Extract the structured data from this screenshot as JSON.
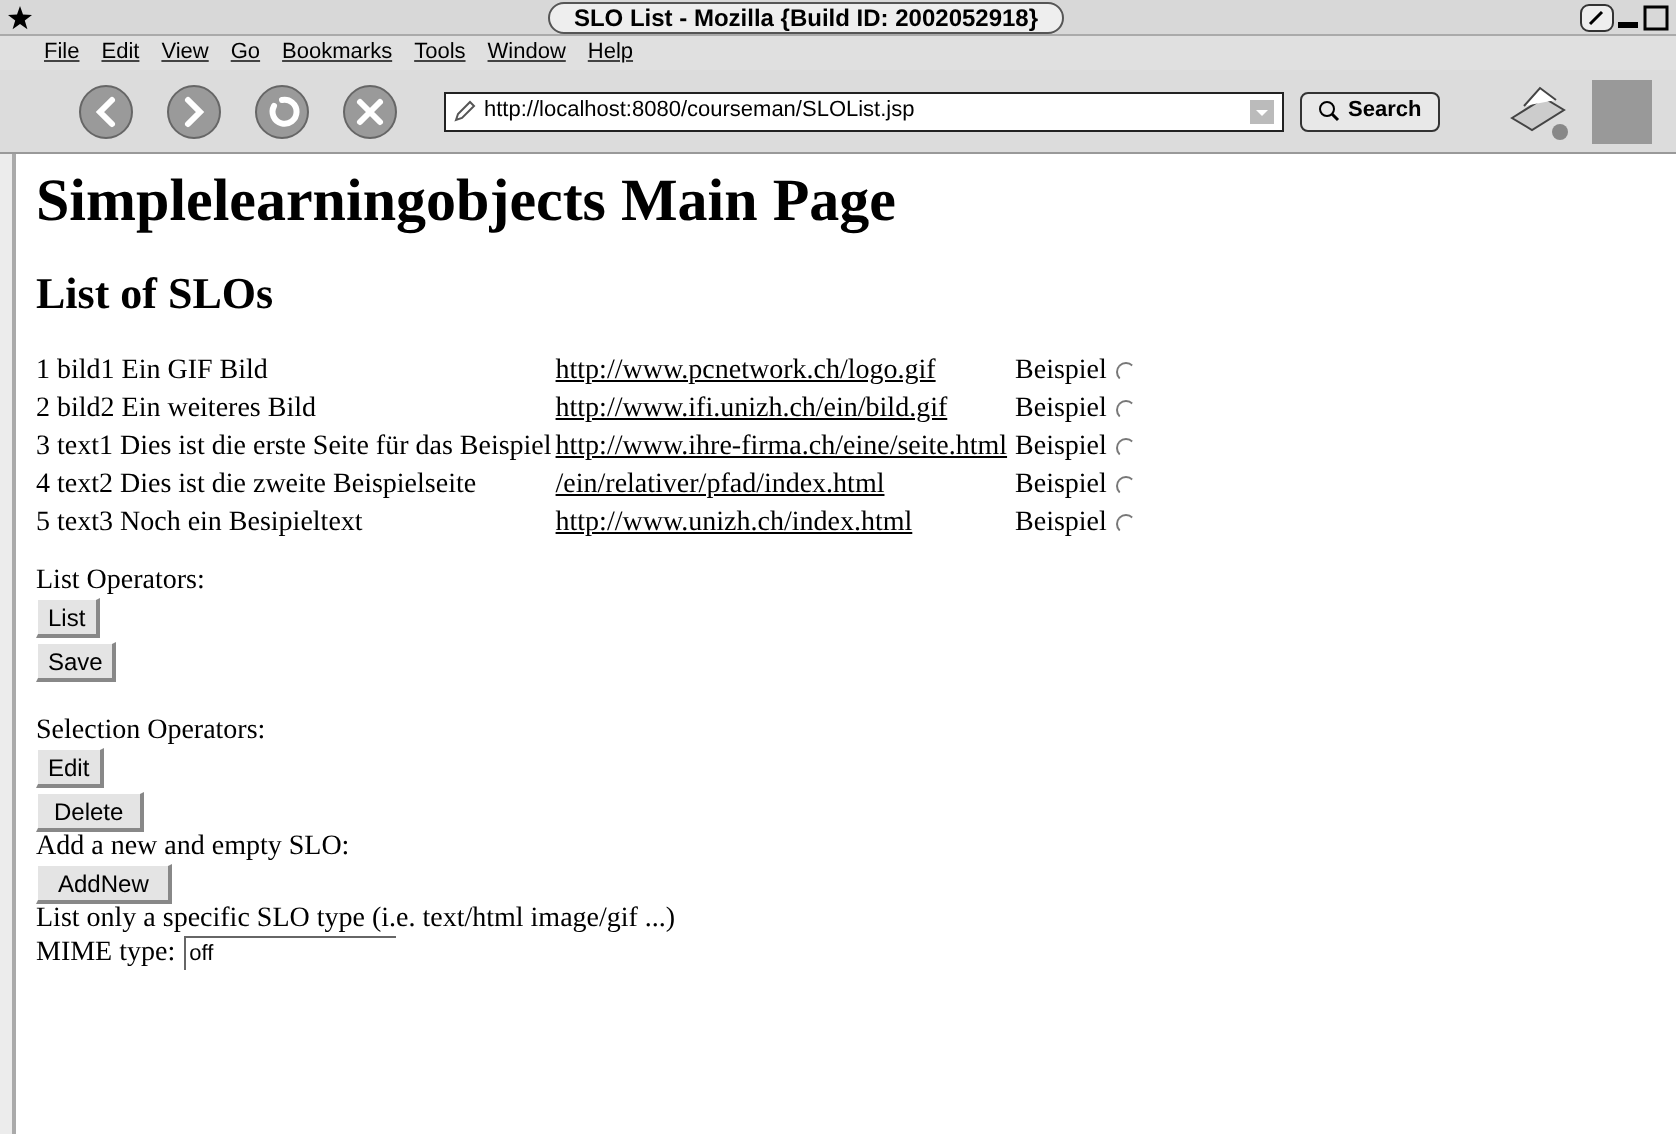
{
  "window": {
    "title": "SLO List - Mozilla {Build ID: 2002052918}"
  },
  "menu": [
    "File",
    "Edit",
    "View",
    "Go",
    "Bookmarks",
    "Tools",
    "Window",
    "Help"
  ],
  "address": {
    "value": "http://localhost:8080/courseman/SLOList.jsp"
  },
  "search_button": "Search",
  "page": {
    "title": "Simplelearningobjects Main Page",
    "subtitle": "List of SLOs",
    "rows": [
      {
        "name": "1 bild1 Ein GIF Bild",
        "url": "http://www.pcnetwork.ch/logo.gif",
        "type": "Beispiel",
        "selected": false
      },
      {
        "name": "2 bild2 Ein weiteres Bild",
        "url": "http://www.ifi.unizh.ch/ein/bild.gif",
        "type": "Beispiel",
        "selected": false
      },
      {
        "name": "3 text1 Dies ist die erste Seite für das Beispiel",
        "url": "http://www.ihre-firma.ch/eine/seite.html",
        "type": "Beispiel",
        "selected": false
      },
      {
        "name": "4 text2 Dies ist die zweite Beispielseite",
        "url": "/ein/relativer/pfad/index.html",
        "type": "Beispiel",
        "selected": false
      },
      {
        "name": "5 text3 Noch ein Besipieltext",
        "url": "http://www.unizh.ch/index.html",
        "type": "Beispiel",
        "selected": false
      }
    ],
    "list_label": "List Operators:",
    "list_buttons": [
      "List",
      "Save"
    ],
    "selection_label": "Selection Operators:",
    "selection_buttons": [
      "Edit",
      "Delete"
    ],
    "add_label": "Add a new and empty SLO:",
    "add_button": "AddNew",
    "filter_text": "List only a specific SLO type (i.e. text/html image/gif ...)",
    "mime_label": "MIME type:",
    "mime_value": "off"
  }
}
